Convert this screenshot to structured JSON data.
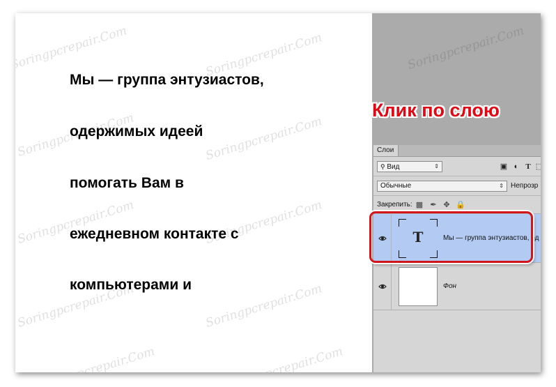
{
  "document": {
    "lines": [
      "Мы — группа энтузиастов,",
      "одержимых идеей",
      "помогать Вам в",
      "ежедневном контакте с",
      "компьютерами и"
    ]
  },
  "watermark": "Soringpcrepair.Com",
  "callout": {
    "text": "Клик по слою",
    "color": "#e30613"
  },
  "layers_panel": {
    "tab_label": "Слои",
    "filter": {
      "value": "Вид"
    },
    "blend_mode": {
      "value": "Обычные"
    },
    "opacity_label": "Непрозр",
    "lock_label": "Закрепить:",
    "filter_icons": [
      "image-filter-icon",
      "adjustment-filter-icon",
      "type-filter-icon",
      "shape-filter-icon"
    ],
    "lock_icons": [
      "lock-pixels-icon",
      "lock-brush-icon",
      "lock-move-icon",
      "lock-all-icon"
    ],
    "layers": [
      {
        "name": "Мы — группа энтузиастов, од",
        "type": "text",
        "visible": true,
        "selected": true,
        "thumb_glyph": "T"
      },
      {
        "name": "Фон",
        "type": "background",
        "visible": true,
        "selected": false
      }
    ],
    "selection_color": "#b3cbf3",
    "highlight_color": "#d4141b"
  }
}
